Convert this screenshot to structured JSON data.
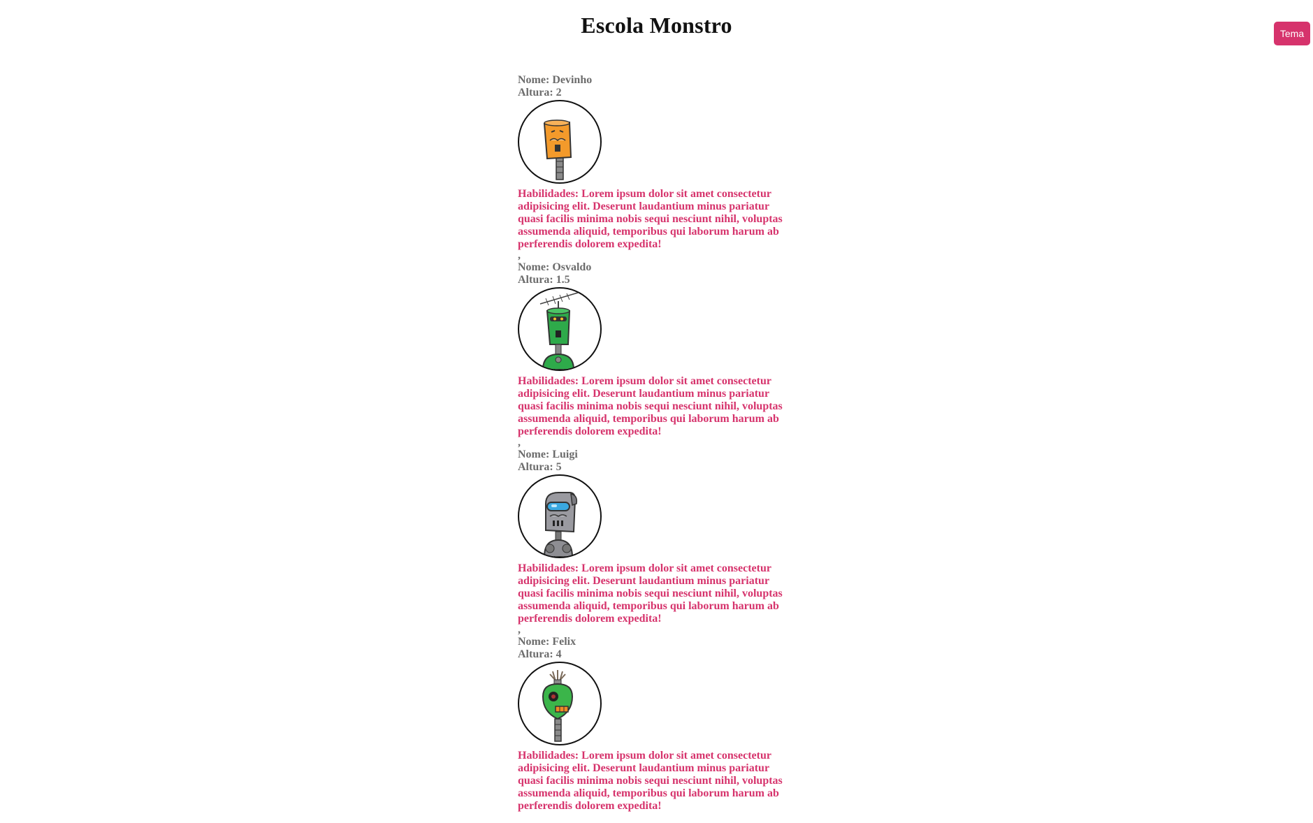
{
  "header": {
    "title": "Escola Monstro",
    "theme_label": "Tema"
  },
  "labels": {
    "name_prefix": "Nome: ",
    "height_prefix": "Altura: ",
    "skills_prefix": "Habilidades: ",
    "separator": ","
  },
  "accent_color": "#d6336c",
  "monsters": [
    {
      "name": "Devinho",
      "height": "2",
      "avatar_icon": "orange-robot-icon",
      "color": "#f39a2b",
      "skills": "Lorem ipsum dolor sit amet consectetur adipisicing elit. Deserunt laudantium minus pariatur quasi facilis minima nobis sequi nesciunt nihil, voluptas assumenda aliquid, temporibus qui laborum harum ab perferendis dolorem expedita!"
    },
    {
      "name": "Osvaldo",
      "height": "1.5",
      "avatar_icon": "green-antenna-robot-icon",
      "color": "#2eaa4a",
      "skills": "Lorem ipsum dolor sit amet consectetur adipisicing elit. Deserunt laudantium minus pariatur quasi facilis minima nobis sequi nesciunt nihil, voluptas assumenda aliquid, temporibus qui laborum harum ab perferendis dolorem expedita!"
    },
    {
      "name": "Luigi",
      "height": "5",
      "avatar_icon": "gray-visor-robot-icon",
      "color": "#8e8e93",
      "skills": "Lorem ipsum dolor sit amet consectetur adipisicing elit. Deserunt laudantium minus pariatur quasi facilis minima nobis sequi nesciunt nihil, voluptas assumenda aliquid, temporibus qui laborum harum ab perferendis dolorem expedita!"
    },
    {
      "name": "Felix",
      "height": "4",
      "avatar_icon": "green-cyclops-robot-icon",
      "color": "#3bb54a",
      "skills": "Lorem ipsum dolor sit amet consectetur adipisicing elit. Deserunt laudantium minus pariatur quasi facilis minima nobis sequi nesciunt nihil, voluptas assumenda aliquid, temporibus qui laborum harum ab perferendis dolorem expedita!"
    }
  ]
}
